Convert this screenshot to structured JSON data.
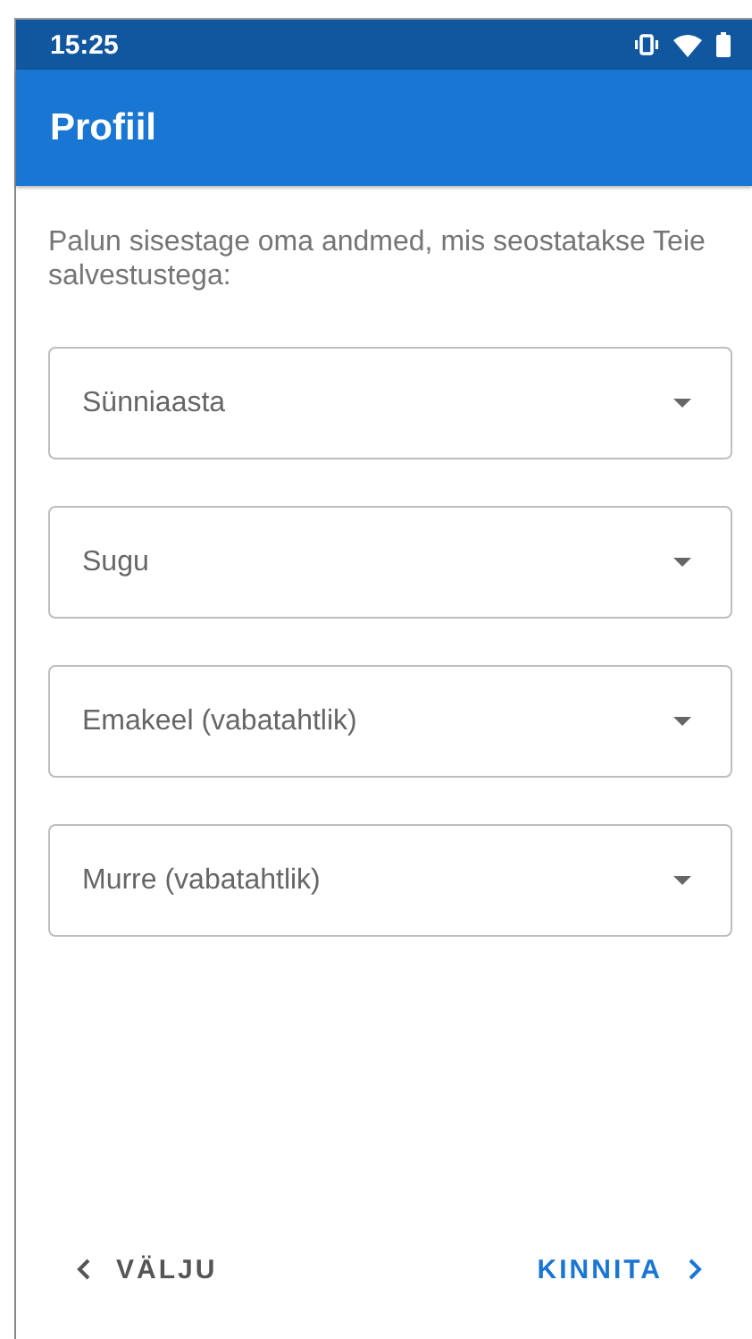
{
  "status_bar": {
    "time": "15:25"
  },
  "app_bar": {
    "title": "Profiil"
  },
  "intro": "Palun sisestage oma andmed, mis seostatakse Teie salvestustega:",
  "fields": [
    {
      "placeholder": "Sünniaasta"
    },
    {
      "placeholder": "Sugu"
    },
    {
      "placeholder": "Emakeel (vabatahtlik)"
    },
    {
      "placeholder": "Murre (vabatahtlik)"
    }
  ],
  "buttons": [
    {
      "label": "VÄLJU",
      "kind": "back"
    },
    {
      "label": "KINNITA",
      "kind": "next"
    }
  ]
}
